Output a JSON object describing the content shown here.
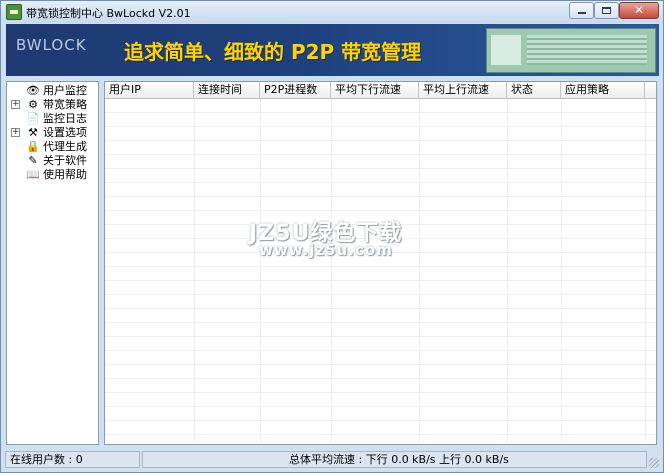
{
  "window": {
    "title": "带宽锁控制中心 BwLockd  V2.01",
    "close_glyph": "✕"
  },
  "banner": {
    "logo": "BWLOCK",
    "slogan": "追求简单、细致的 P2P 带宽管理"
  },
  "tree": {
    "items": [
      {
        "label": "用户监控",
        "icon": "👁",
        "expander": ""
      },
      {
        "label": "带宽策略",
        "icon": "⚙",
        "expander": "+"
      },
      {
        "label": "监控日志",
        "icon": "📄",
        "expander": ""
      },
      {
        "label": "设置选项",
        "icon": "⚒",
        "expander": "+"
      },
      {
        "label": "代理生成",
        "icon": "🔒",
        "expander": ""
      },
      {
        "label": "关于软件",
        "icon": "✎",
        "expander": ""
      },
      {
        "label": "使用帮助",
        "icon": "📖",
        "expander": ""
      }
    ]
  },
  "table": {
    "columns": [
      "用户IP",
      "连接时间",
      "P2P进程数",
      "平均下行流速",
      "平均上行流速",
      "状态",
      "应用策略"
    ]
  },
  "watermark": {
    "line1": "JZ5U绿色下载",
    "line2": "www.jz5u.com"
  },
  "status": {
    "online_users": "在线用户数 : 0",
    "avg_speed": "总体平均流速 :  下行 0.0 kB/s   上行 0.0 kB/s"
  },
  "colors": {
    "banner_bg": "#1f3a72",
    "slogan": "#ffd200"
  }
}
